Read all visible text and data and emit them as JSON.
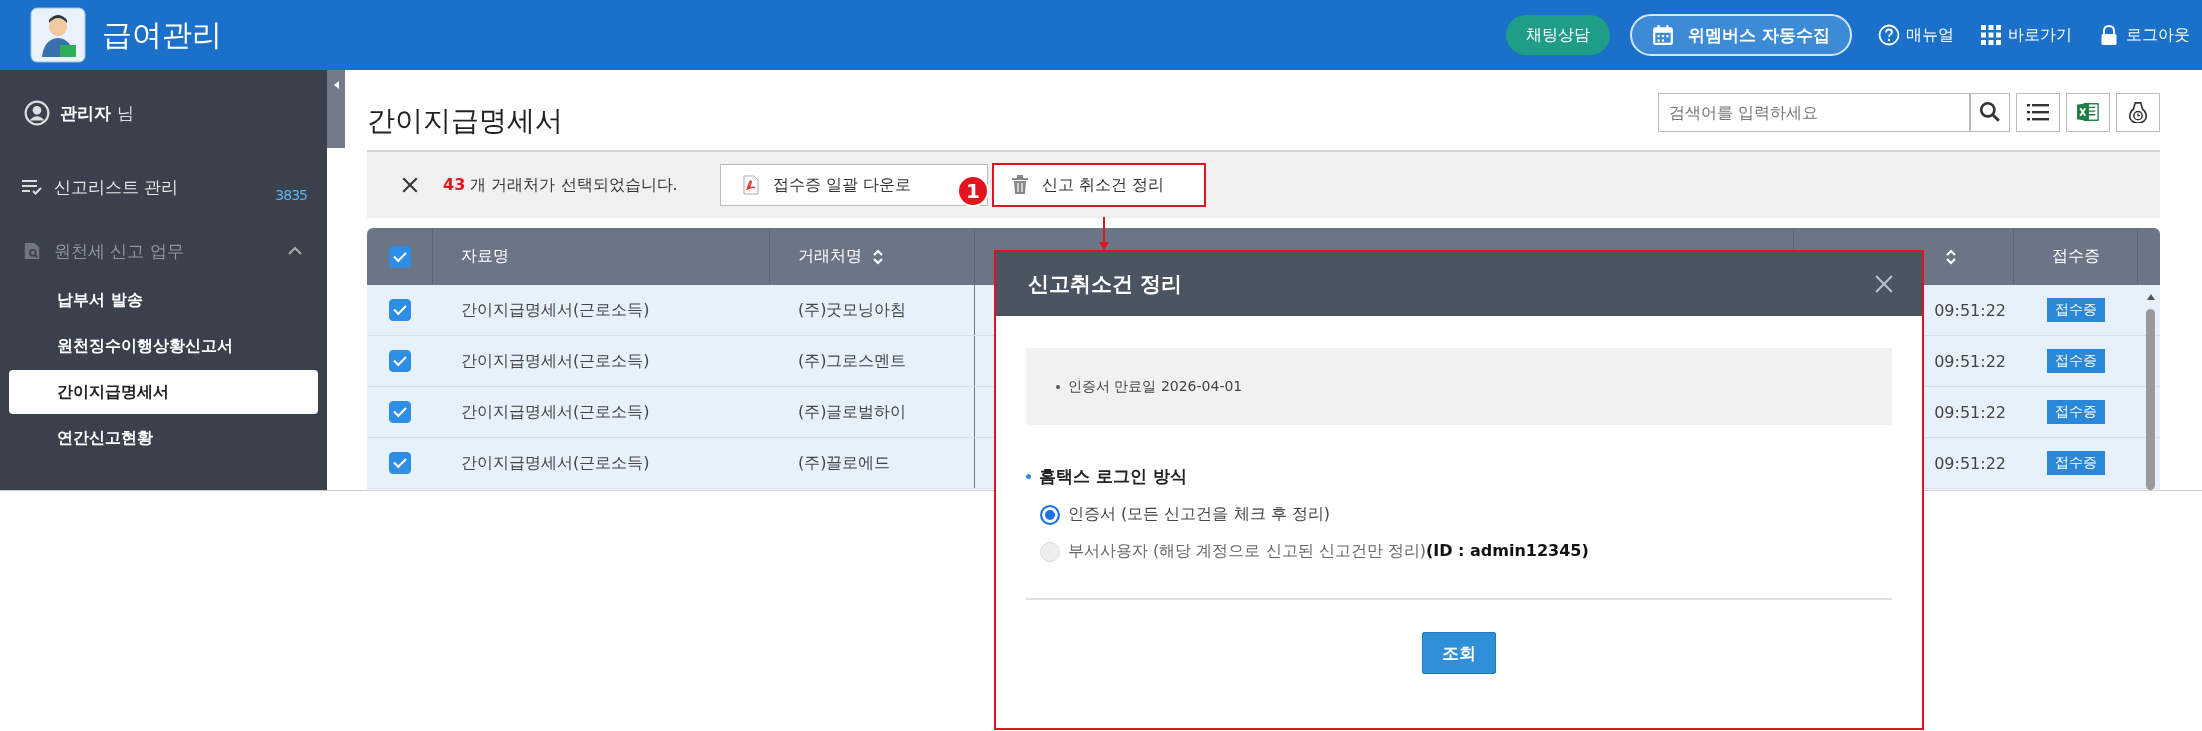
{
  "header": {
    "title": "급여관리",
    "chat_button": "채팅상담",
    "collect_button": "위멤버스 자동수집",
    "links": [
      {
        "kind": "help",
        "label": "매뉴얼"
      },
      {
        "kind": "grid",
        "label": "바로가기"
      },
      {
        "kind": "lock",
        "label": "로그아웃"
      }
    ]
  },
  "sidebar": {
    "user": {
      "name": "관리자",
      "suffix": "님"
    },
    "items": [
      {
        "kind": "link",
        "label": "신고리스트 관리",
        "count": "3835"
      },
      {
        "kind": "group",
        "label": "원천세 신고 업무",
        "expanded": true,
        "children": [
          {
            "label": "납부서 발송",
            "selected": false
          },
          {
            "label": "원천징수이행상황신고서",
            "selected": false
          },
          {
            "label": "간이지급명세서",
            "selected": true
          },
          {
            "label": "연간신고현황",
            "selected": false
          }
        ]
      }
    ]
  },
  "page": {
    "title": "간이지급명세서",
    "search": {
      "placeholder": "검색어를 입력하세요"
    }
  },
  "selection_bar": {
    "count": "43",
    "message": "개 거래처가 선택되었습니다.",
    "buttons": [
      {
        "kind": "pdf",
        "label": "접수증 일괄 다운로",
        "highlighted": false
      },
      {
        "kind": "trash",
        "label": "신고 취소건 정리",
        "highlighted": true
      }
    ],
    "callout": "1"
  },
  "table": {
    "columns": [
      {
        "kind": "check",
        "checked": true
      },
      {
        "kind": "text",
        "label": "자료명",
        "sortable": false
      },
      {
        "kind": "text",
        "label": "거래처명",
        "sortable": true
      },
      {
        "kind": "covered"
      },
      {
        "kind": "covered",
        "sortable": true
      },
      {
        "kind": "text",
        "label": "접수증",
        "sortable": false
      }
    ],
    "rows": [
      {
        "checked": true,
        "name": "간이지급명세서(근로소득)",
        "partner": "(주)굿모닝아침",
        "time": "09:51:22",
        "receipt": "접수증"
      },
      {
        "checked": true,
        "name": "간이지급명세서(근로소득)",
        "partner": "(주)그로스멘트",
        "time": "09:51:22",
        "receipt": "접수증"
      },
      {
        "checked": true,
        "name": "간이지급명세서(근로소득)",
        "partner": "(주)글로벌하이",
        "time": "09:51:22",
        "receipt": "접수증"
      },
      {
        "checked": true,
        "name": "간이지급명세서(근로소득)",
        "partner": "(주)끌로에드",
        "time": "09:51:22",
        "receipt": "접수증"
      }
    ]
  },
  "dialog": {
    "title": "신고취소건 정리",
    "info": [
      "인증서 만료일 2026-04-01"
    ],
    "section_title": "홈택스 로그인 방식",
    "options": [
      {
        "label": "인증서 (모든 신고건을 체크 후 정리)",
        "selected": true,
        "disabled": false
      },
      {
        "label": "부서사용자 (해당 계정으로 신고된 신고건만 정리)**(ID : admin12345)**",
        "selected": false,
        "disabled": true
      }
    ],
    "button": "조회"
  }
}
